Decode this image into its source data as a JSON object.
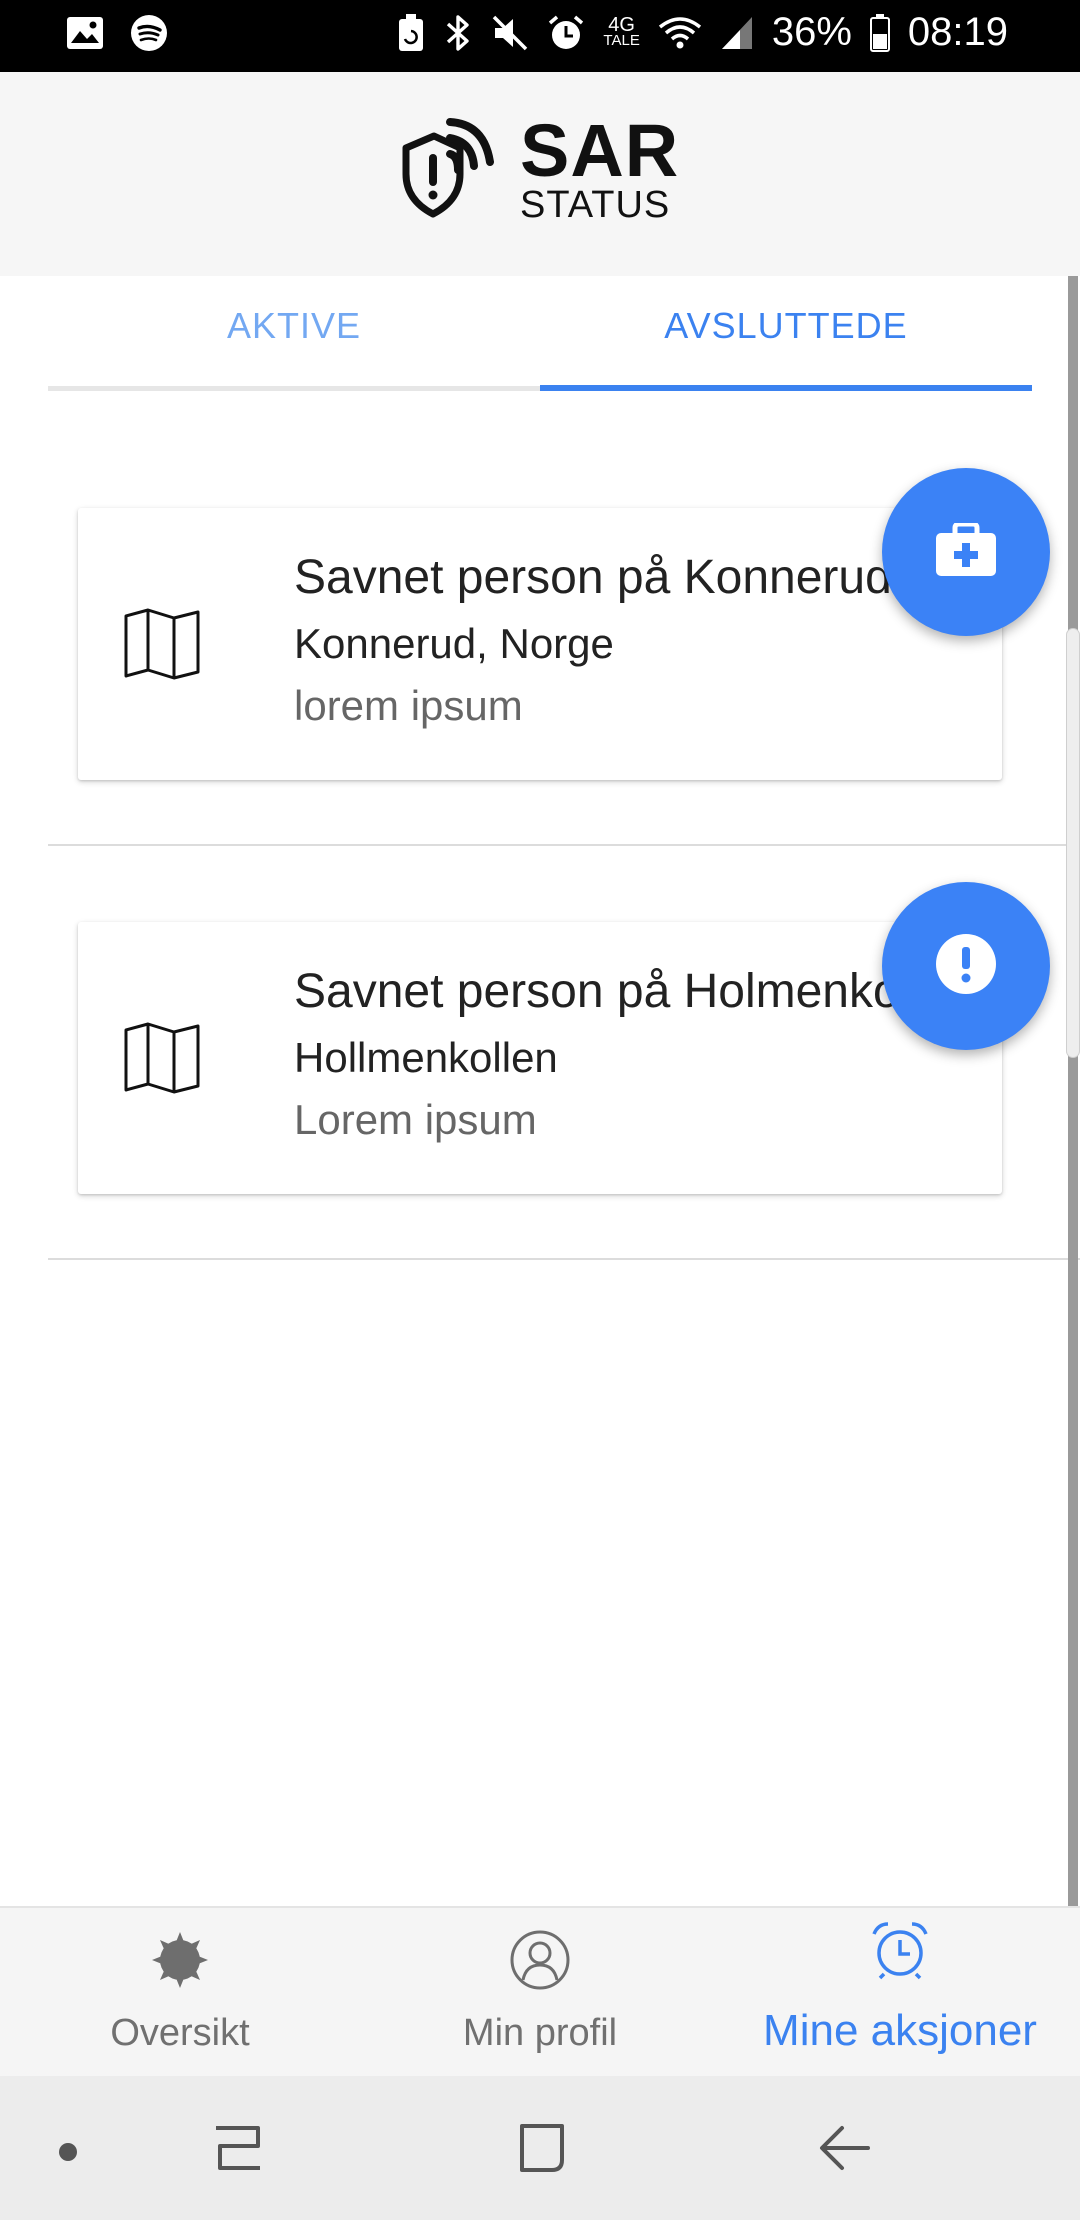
{
  "status_bar": {
    "network": "4G",
    "network_sub": "TALE",
    "battery": "36%",
    "time": "08:19",
    "icons_left": [
      "gallery-icon",
      "spotify-icon"
    ],
    "icons_right": [
      "battery-saver-icon",
      "bluetooth-icon",
      "mute-icon",
      "alarm-icon",
      "wifi-icon",
      "signal-icon",
      "battery-icon"
    ]
  },
  "header": {
    "logo_title": "SAR",
    "logo_subtitle": "STATUS"
  },
  "tabs": [
    {
      "label": "AKTIVE",
      "selected": false
    },
    {
      "label": "AVSLUTTEDE",
      "selected": true
    }
  ],
  "cards": [
    {
      "title": "Savnet person på Konnerud",
      "location": "Konnerud, Norge",
      "description": "lorem ipsum",
      "fab_icon": "medical-kit-icon"
    },
    {
      "title": "Savnet person på Holmenkollen",
      "location": "Hollmenkollen",
      "description": "Lorem ipsum",
      "fab_icon": "alert-icon"
    }
  ],
  "bottom_nav": [
    {
      "label": "Oversikt",
      "icon": "gear-icon",
      "selected": false
    },
    {
      "label": "Min profil",
      "icon": "profile-icon",
      "selected": false
    },
    {
      "label": "Mine aksjoner",
      "icon": "alarm-clock-icon",
      "selected": true
    }
  ],
  "colors": {
    "accent": "#3b82f6",
    "header_bg": "#f6f6f6",
    "status_bar": "#000000"
  }
}
